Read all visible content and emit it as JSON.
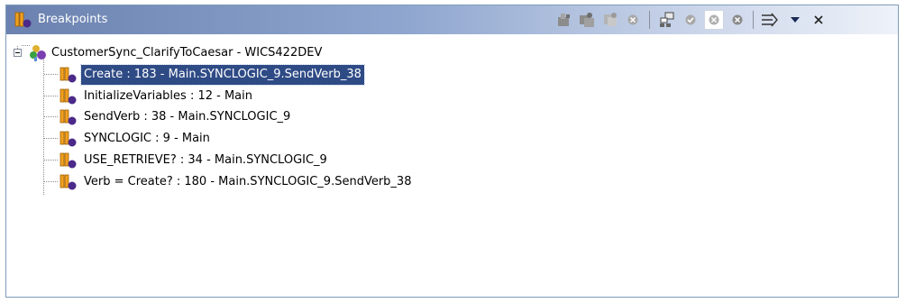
{
  "view": {
    "title": "Breakpoints",
    "toolbar": [
      {
        "name": "remove-breakpoint-icon"
      },
      {
        "name": "remove-all-breakpoints-icon"
      },
      {
        "name": "remove-grey-breakpoints-icon"
      },
      {
        "name": "remove-circle-icon"
      },
      {
        "name": "select-all-icon"
      },
      {
        "name": "enable-breakpoint-icon"
      },
      {
        "name": "disable-breakpoint-icon"
      },
      {
        "name": "disable-all-icon"
      },
      {
        "name": "skip-breakpoints-icon"
      },
      {
        "name": "view-menu-icon"
      },
      {
        "name": "close-icon"
      }
    ]
  },
  "tree": {
    "root": {
      "label": "CustomerSync_ClarifyToCaesar - WICS422DEV"
    },
    "items": [
      {
        "label": "Create : 183 - Main.SYNCLOGIC_9.SendVerb_38",
        "selected": true
      },
      {
        "label": "InitializeVariables : 12 - Main",
        "selected": false
      },
      {
        "label": "SendVerb : 38 - Main.SYNCLOGIC_9",
        "selected": false
      },
      {
        "label": "SYNCLOGIC : 9 - Main",
        "selected": false
      },
      {
        "label": "USE_RETRIEVE? : 34 - Main.SYNCLOGIC_9",
        "selected": false
      },
      {
        "label": "Verb = Create? : 180 - Main.SYNCLOGIC_9.SendVerb_38",
        "selected": false
      }
    ]
  },
  "colors": {
    "selection": "#2f4b86",
    "title_gradient_start": "#6b82b0",
    "border": "#7f9db9"
  }
}
